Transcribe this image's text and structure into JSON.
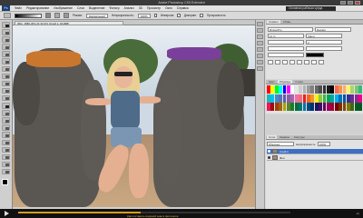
{
  "window": {
    "title": "Adobe Photoshop CS5 Extended"
  },
  "menubar": {
    "logo": "Ps",
    "items": [
      "Файл",
      "Редактирование",
      "Изображение",
      "Слои",
      "Выделение",
      "Фильтр",
      "Анализ",
      "3D",
      "Просмотр",
      "Окно",
      "Справка"
    ],
    "workspace": "Основная рабочая среда"
  },
  "options": {
    "mode_label": "Режим:",
    "mode_value": "Нормальный",
    "opacity_label": "Непрозрачность:",
    "opacity_value": "100%",
    "reverse_label": "Инверсия",
    "dither_label": "Дизеринг",
    "transparency_label": "Прозрачность"
  },
  "document": {
    "tab_label": "IMG_1580.JPG @ 33,3% (Слой 1, RGB/8)",
    "zoom": "33,33%"
  },
  "panels": {
    "character_tabs": [
      "Символ",
      "Абзац"
    ],
    "font_family": "Myriad Pro",
    "font_style": "Regular",
    "font_size": "12 пт",
    "leading": "(Авто)",
    "tracking": "0",
    "swatch_tabs": [
      "Цвет",
      "Образцы",
      "Стили"
    ],
    "layers_tabs": [
      "Слои",
      "Каналы",
      "Контуры"
    ],
    "blend_mode": "Обычные",
    "opacity_label": "Непрозрачность:",
    "opacity_value": "100%",
    "layers": [
      {
        "name": "Слой 1",
        "selected": true
      },
      {
        "name": "Фон",
        "selected": false
      }
    ]
  },
  "swatch_colors": [
    "#ff0000",
    "#ffff00",
    "#00ff00",
    "#00ffff",
    "#0000ff",
    "#ff00ff",
    "#ffffff",
    "#e6e6e6",
    "#cccccc",
    "#b3b3b3",
    "#999999",
    "#808080",
    "#666666",
    "#4d4d4d",
    "#333333",
    "#1a1a1a",
    "#000000",
    "#f26c4f",
    "#f68e55",
    "#fbaf5c",
    "#fff467",
    "#acd372",
    "#7cc576",
    "#3bb878",
    "#1abbb4",
    "#00bff3",
    "#438ccb",
    "#5574b9",
    "#605ca8",
    "#855fa8",
    "#a763a8",
    "#f06ea9",
    "#f26d7d",
    "#ed1c24",
    "#f26522",
    "#f7941d",
    "#fff200",
    "#8dc73f",
    "#39b54a",
    "#00a651",
    "#00a99d",
    "#00aeef",
    "#0072bc",
    "#0054a6",
    "#2e3192",
    "#662d91",
    "#92278f",
    "#ec008c",
    "#ed145b",
    "#9e0b0f",
    "#a0410d",
    "#a36209",
    "#aba000",
    "#598527",
    "#1a7b30",
    "#007236",
    "#00746b",
    "#0076a3",
    "#004a80",
    "#003471",
    "#1b1464",
    "#440e62",
    "#630460",
    "#9e005d",
    "#9e0039",
    "#790000",
    "#7b2e00",
    "#7d4900",
    "#827b00",
    "#406618",
    "#005e20",
    "#005826"
  ],
  "taskbar": {
    "caption": "Как поставить водяной знак в фотошопе",
    "progress": 0.45
  }
}
